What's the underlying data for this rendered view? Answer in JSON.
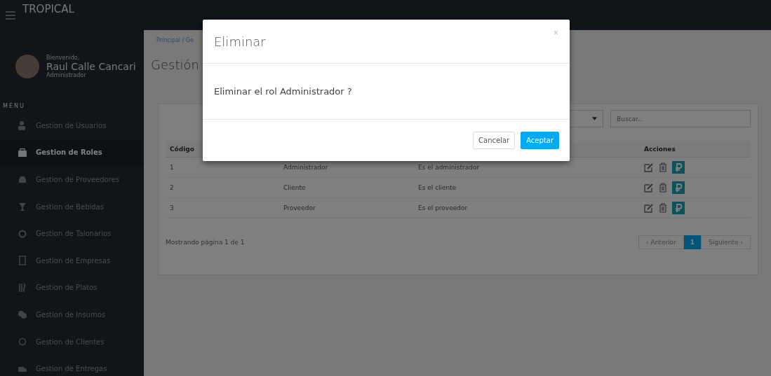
{
  "topbar": {
    "brand": "TROPICAL"
  },
  "user": {
    "greeting": "Bienvenido,",
    "name": "Raul Calle Cancari",
    "role": "Administrador"
  },
  "sidebar": {
    "heading": "MENU",
    "items": [
      {
        "label": "Gestion de Usuarios",
        "selected": false
      },
      {
        "label": "Gestion de Roles",
        "selected": true
      },
      {
        "label": "Gestion de Proveedores",
        "selected": false
      },
      {
        "label": "Gestion de Bebidas",
        "selected": false
      },
      {
        "label": "Gestion de Talonarios",
        "selected": false
      },
      {
        "label": "Gestion de Empresas",
        "selected": false
      },
      {
        "label": "Gestion de Platos",
        "selected": false
      },
      {
        "label": "Gestion de Insumos",
        "selected": false
      },
      {
        "label": "Gestion de Clientes",
        "selected": false
      },
      {
        "label": "Gestion de Entregas",
        "selected": false
      }
    ]
  },
  "breadcrumb": "Principal / Ge",
  "page_title": "Gestión",
  "search": {
    "placeholder": "Buscar..."
  },
  "table": {
    "columns": [
      "Código",
      "Acciones"
    ],
    "rows": [
      {
        "code": "1",
        "name": "Administrador",
        "description": "Es el administrador"
      },
      {
        "code": "2",
        "name": "Cliente",
        "description": "Es el cliente"
      },
      {
        "code": "3",
        "name": "Proveedor",
        "description": "Es el proveedor"
      }
    ]
  },
  "footer": {
    "info": "Mostrando página 1 de 1",
    "pages": [
      {
        "label": "‹ Anterior",
        "kind": "nav",
        "selected": false
      },
      {
        "label": "1",
        "kind": "page",
        "selected": true
      },
      {
        "label": "Siguiente ›",
        "kind": "nav",
        "selected": false
      }
    ]
  },
  "modal": {
    "title": "Eliminar",
    "close": "×",
    "message": "Eliminar el rol Administrador ?",
    "buttons": [
      {
        "label": "Cancelar",
        "kind": "default"
      },
      {
        "label": "Aceptar",
        "kind": "primary"
      }
    ]
  }
}
